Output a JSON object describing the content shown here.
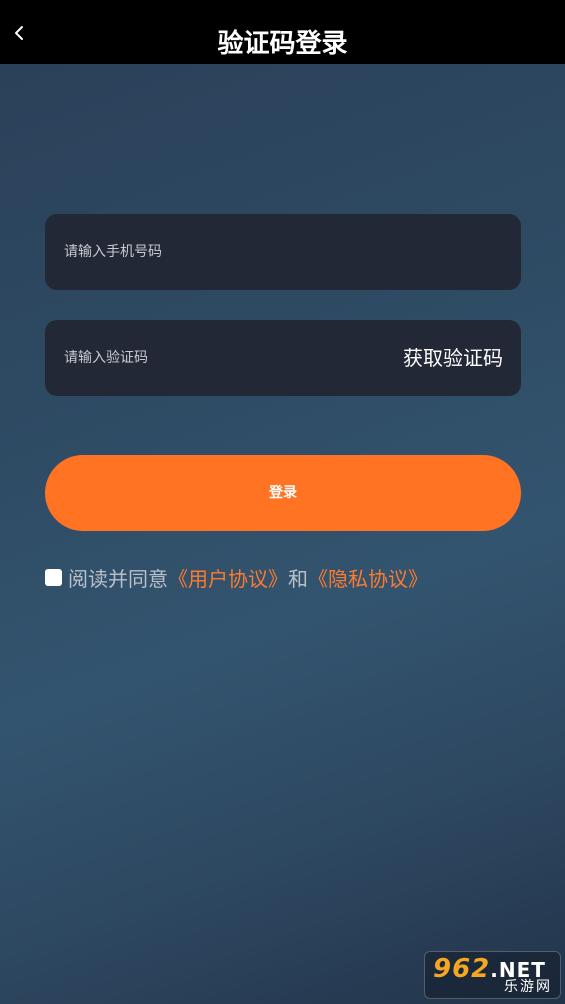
{
  "header": {
    "back_icon": "chevron-left-icon",
    "title": "验证码登录"
  },
  "form": {
    "phone_placeholder": "请输入手机号码",
    "code_placeholder": "请输入验证码",
    "get_code_label": "获取验证码",
    "login_label": "登录"
  },
  "agreement": {
    "prefix": "阅读并同意",
    "user_agreement": "《用户协议》",
    "conjunction": "和",
    "privacy_agreement": "《隐私协议》"
  },
  "watermark": {
    "brand_number": "962",
    "brand_suffix": ".NET",
    "brand_name": "乐游网"
  },
  "colors": {
    "accent": "#ff7322",
    "link": "#ff7a2e",
    "field_bg": "#222836",
    "header_bg": "#000000"
  }
}
